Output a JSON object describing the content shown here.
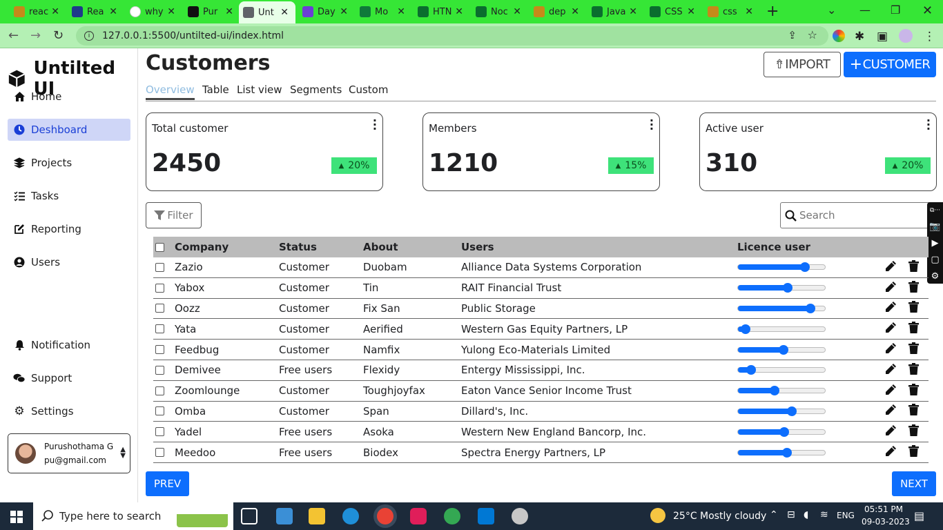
{
  "browser": {
    "tabs": [
      {
        "label": "reac",
        "color": "#c58a1a"
      },
      {
        "label": "Rea",
        "color": "#1e3a8a"
      },
      {
        "label": "why",
        "color": "#ffffff"
      },
      {
        "label": "Pur",
        "color": "#111111"
      },
      {
        "label": "Unt",
        "color": "#5f6368"
      },
      {
        "label": "Day",
        "color": "#6b3fd6"
      },
      {
        "label": "Mo",
        "color": "#0f7a3a"
      },
      {
        "label": "HTN",
        "color": "#0a6e2e"
      },
      {
        "label": "Noc",
        "color": "#0a6e2e"
      },
      {
        "label": "dep",
        "color": "#c58a1a"
      },
      {
        "label": "Java",
        "color": "#0a6e2e"
      },
      {
        "label": "CSS",
        "color": "#0a6e2e"
      },
      {
        "label": "css",
        "color": "#c58a1a"
      }
    ],
    "url": "127.0.0.1:5500/untilted-ui/index.html"
  },
  "sidebar": {
    "brand": "Untilted UI",
    "items": [
      {
        "label": "Home"
      },
      {
        "label": "Deshboard"
      },
      {
        "label": "Projects"
      },
      {
        "label": "Tasks"
      },
      {
        "label": "Reporting"
      },
      {
        "label": "Users"
      }
    ],
    "bottom_items": [
      {
        "label": "Notification"
      },
      {
        "label": "Support"
      },
      {
        "label": "Settings"
      }
    ],
    "profile": {
      "name": "Purushothama G",
      "email": "pu@gmail.com"
    }
  },
  "header": {
    "title": "Customers",
    "import_label": "IMPORT",
    "customer_label": "CUSTOMER"
  },
  "tabs": [
    "Overview",
    "Table",
    "List view",
    "Segments",
    "Custom"
  ],
  "stats": [
    {
      "label": "Total customer",
      "value": "2450",
      "change": "20%"
    },
    {
      "label": "Members",
      "value": "1210",
      "change": "15%"
    },
    {
      "label": "Active user",
      "value": "310",
      "change": "20%"
    }
  ],
  "filter_label": "Filter",
  "search": {
    "placeholder": "Search"
  },
  "table": {
    "columns": [
      "Company",
      "Status",
      "About",
      "Users",
      "Licence user"
    ],
    "rows": [
      {
        "company": "Zazio",
        "status": "Customer",
        "about": "Duobam",
        "users": "Alliance Data Systems Corporation",
        "licence": 0.77
      },
      {
        "company": "Yabox",
        "status": "Customer",
        "about": "Tin",
        "users": "RAIT Financial Trust",
        "licence": 0.57
      },
      {
        "company": "Oozz",
        "status": "Customer",
        "about": "Fix San",
        "users": "Public Storage",
        "licence": 0.83
      },
      {
        "company": "Yata",
        "status": "Customer",
        "about": "Aerified",
        "users": "Western Gas Equity Partners, LP",
        "licence": 0.09
      },
      {
        "company": "Feedbug",
        "status": "Customer",
        "about": "Namfix",
        "users": "Yulong Eco-Materials Limited",
        "licence": 0.52
      },
      {
        "company": "Demivee",
        "status": "Free users",
        "about": "Flexidy",
        "users": "Entergy Mississippi, Inc.",
        "licence": 0.15
      },
      {
        "company": "Zoomlounge",
        "status": "Customer",
        "about": "Toughjoyfax",
        "users": "Eaton Vance Senior Income Trust",
        "licence": 0.42
      },
      {
        "company": "Omba",
        "status": "Customer",
        "about": "Span",
        "users": "Dillard's, Inc.",
        "licence": 0.62
      },
      {
        "company": "Yadel",
        "status": "Free users",
        "about": "Asoka",
        "users": "Western New England Bancorp, Inc.",
        "licence": 0.53
      },
      {
        "company": "Meedoo",
        "status": "Free users",
        "about": "Biodex",
        "users": "Spectra Energy Partners, LP",
        "licence": 0.56
      }
    ]
  },
  "pagination": {
    "prev": "PREV",
    "next": "NEXT"
  },
  "taskbar": {
    "search_placeholder": "Type here to search",
    "weather": "25°C  Mostly cloudy",
    "lang": "ENG",
    "time": "05:51 PM",
    "date": "09-03-2023"
  },
  "colors": {
    "accent": "#0d6efd",
    "badge": "#3ee27a",
    "nav_active": "#cfd6f7",
    "browser_bar": "#36e636"
  }
}
